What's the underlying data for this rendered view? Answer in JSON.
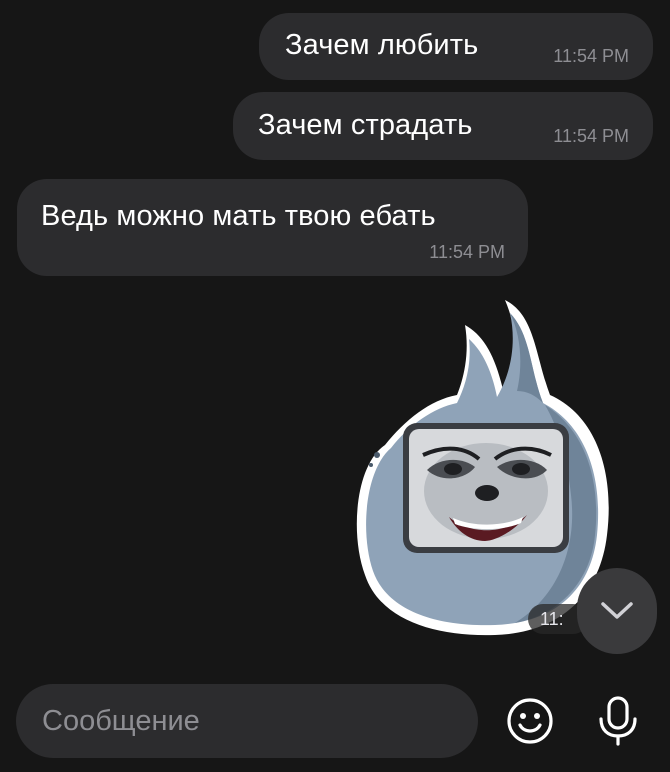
{
  "messages": [
    {
      "text": "Зачем любить",
      "time": "11:54 PM"
    },
    {
      "text": "Зачем страдать",
      "time": "11:54 PM"
    },
    {
      "text": "Ведь можно мать твою ебать",
      "time": "11:54 PM"
    }
  ],
  "sticker": {
    "time_visible": "11:"
  },
  "input": {
    "placeholder": "Сообщение"
  },
  "icons": {
    "scroll": "chevron-down-icon",
    "emoji": "emoji-icon",
    "mic": "microphone-icon"
  },
  "colors": {
    "background": "#161616",
    "bubble": "#2c2c2e",
    "time": "#8e8e93",
    "sticker_body": "#8fa3b8"
  }
}
